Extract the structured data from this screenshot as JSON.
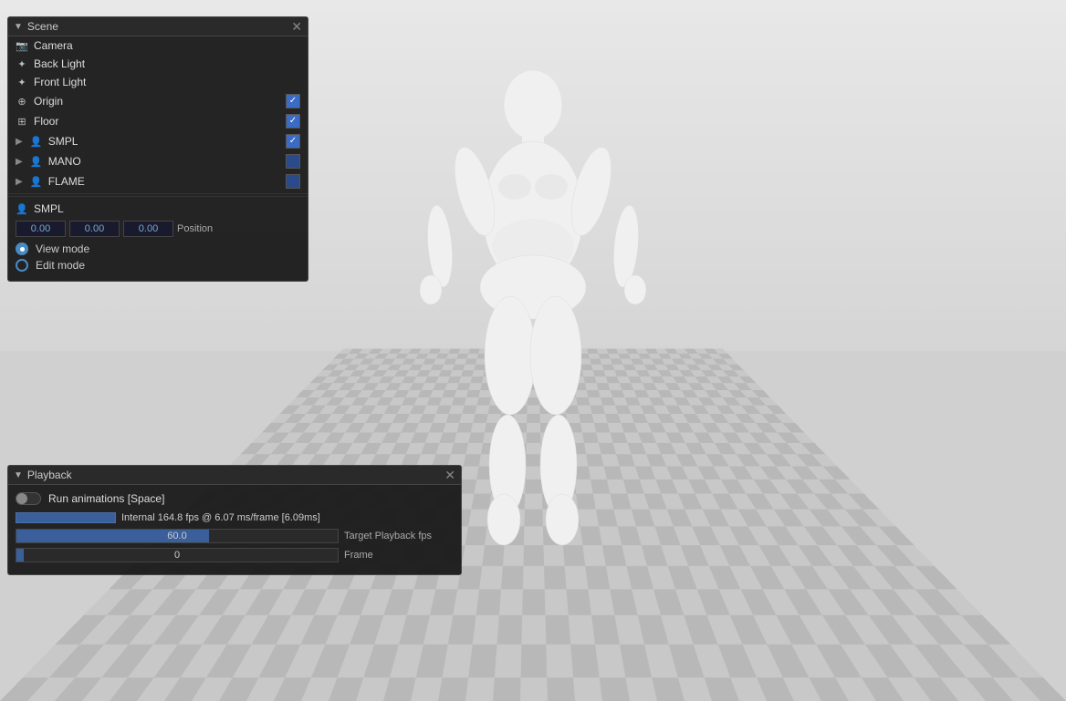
{
  "viewport": {
    "background_color": "#d0d0d0"
  },
  "scene_panel": {
    "title": "Scene",
    "items": [
      {
        "id": "camera",
        "icon": "📷",
        "label": "Camera",
        "has_checkbox": false,
        "checked": null,
        "expandable": false
      },
      {
        "id": "back-light",
        "icon": "💡",
        "label": "Back Light",
        "has_checkbox": false,
        "checked": null,
        "expandable": false
      },
      {
        "id": "front-light",
        "icon": "💡",
        "label": "Front Light",
        "has_checkbox": false,
        "checked": null,
        "expandable": false
      },
      {
        "id": "origin",
        "icon": "⊕",
        "label": "Origin",
        "has_checkbox": true,
        "checked": true,
        "expandable": false
      },
      {
        "id": "floor",
        "icon": "⊞",
        "label": "Floor",
        "has_checkbox": true,
        "checked": true,
        "expandable": false
      },
      {
        "id": "smpl",
        "icon": "👤",
        "label": "SMPL",
        "has_checkbox": true,
        "checked": true,
        "expandable": true
      },
      {
        "id": "mano",
        "icon": "👤",
        "label": "MANO",
        "has_checkbox": true,
        "checked": false,
        "expandable": true
      },
      {
        "id": "flame",
        "icon": "👤",
        "label": "FLAME",
        "has_checkbox": true,
        "checked": false,
        "expandable": true
      }
    ],
    "smpl_section": {
      "label": "SMPL",
      "position": {
        "x": "0.00",
        "y": "0.00",
        "z": "0.00",
        "label": "Position"
      },
      "view_mode": {
        "label": "View mode",
        "active": true
      },
      "edit_mode": {
        "label": "Edit mode",
        "active": false
      }
    }
  },
  "playback_panel": {
    "title": "Playback",
    "run_animations": {
      "label": "Run animations [Space]",
      "active": false
    },
    "fps_info": {
      "text": "Internal 164.8 fps @ 6.07 ms/frame [6.09ms]"
    },
    "target_playback": {
      "value": "60.0",
      "label": "Target Playback fps",
      "fill_percent": 60
    },
    "frame": {
      "value": "0",
      "label": "Frame",
      "fill_percent": 2
    }
  },
  "icons": {
    "close": "✕",
    "collapse": "▼",
    "check": "✓",
    "expand_right": "▶"
  }
}
